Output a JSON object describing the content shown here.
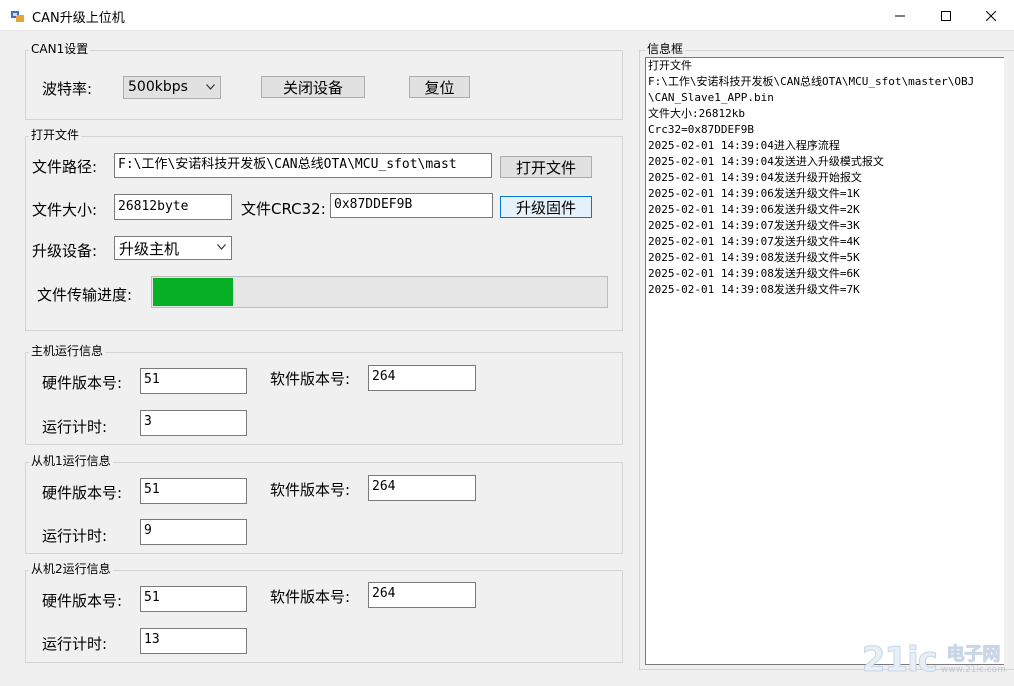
{
  "window": {
    "title": "CAN升级上位机"
  },
  "can1": {
    "title": "CAN1设置",
    "baud_label": "波特率:",
    "baud_value": "500kbps",
    "close_button": "关闭设备",
    "reset_button": "复位"
  },
  "file": {
    "title": "打开文件",
    "path_label": "文件路径:",
    "path_value": "F:\\工作\\安诺科技开发板\\CAN总线OTA\\MCU_sfot\\mast",
    "open_button": "打开文件",
    "size_label": "文件大小:",
    "size_value": "26812byte",
    "crc_label": "文件CRC32:",
    "crc_value": "0x87DDEF9B",
    "upgrade_button": "升级固件",
    "device_label": "升级设备:",
    "device_value": "升级主机",
    "progress_label": "文件传输进度:",
    "progress_fraction": 0.18
  },
  "host": {
    "title": "主机运行信息",
    "hw_label": "硬件版本号:",
    "hw_value": "51",
    "sw_label": "软件版本号:",
    "sw_value": "264",
    "time_label": "运行计时:",
    "time_value": "3"
  },
  "slave1": {
    "title": "从机1运行信息",
    "hw_label": "硬件版本号:",
    "hw_value": "51",
    "sw_label": "软件版本号:",
    "sw_value": "264",
    "time_label": "运行计时:",
    "time_value": "9"
  },
  "slave2": {
    "title": "从机2运行信息",
    "hw_label": "硬件版本号:",
    "hw_value": "51",
    "sw_label": "软件版本号:",
    "sw_value": "264",
    "time_label": "运行计时:",
    "time_value": "13"
  },
  "info": {
    "title": "信息框",
    "lines": [
      "打开文件",
      "F:\\工作\\安诺科技开发板\\CAN总线OTA\\MCU_sfot\\master\\OBJ",
      "\\CAN_Slave1_APP.bin",
      "文件大小:26812kb",
      "Crc32=0x87DDEF9B",
      "2025-02-01 14:39:04进入程序流程",
      "2025-02-01 14:39:04发送进入升级模式报文",
      "2025-02-01 14:39:04发送升级开始报文",
      "2025-02-01 14:39:06发送升级文件=1K",
      "2025-02-01 14:39:06发送升级文件=2K",
      "2025-02-01 14:39:07发送升级文件=3K",
      "2025-02-01 14:39:07发送升级文件=4K",
      "2025-02-01 14:39:08发送升级文件=5K",
      "2025-02-01 14:39:08发送升级文件=6K",
      "2025-02-01 14:39:08发送升级文件=7K"
    ]
  },
  "watermark": {
    "logo": "21ic",
    "cn": "电子网",
    "url": "www.21ic.com"
  },
  "colors": {
    "progress": "#06b025",
    "focus": "#0078d7"
  }
}
